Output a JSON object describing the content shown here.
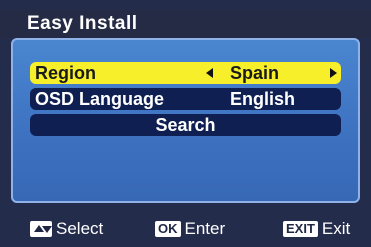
{
  "window": {
    "title": "Easy Install"
  },
  "menu": {
    "region": {
      "label": "Region",
      "value": "Spain"
    },
    "osd_language": {
      "label": "OSD Language",
      "value": "English"
    },
    "search": {
      "label": "Search"
    }
  },
  "footer": {
    "select": {
      "key_icon": "up-down-keys-icon",
      "label": "Select"
    },
    "enter": {
      "key": "OK",
      "label": "Enter"
    },
    "exit": {
      "key": "EXIT",
      "label": "Exit"
    }
  },
  "colors": {
    "highlight": "#f6ef2a",
    "item_bg": "#0f1f52",
    "panel": "#4a86d0"
  }
}
